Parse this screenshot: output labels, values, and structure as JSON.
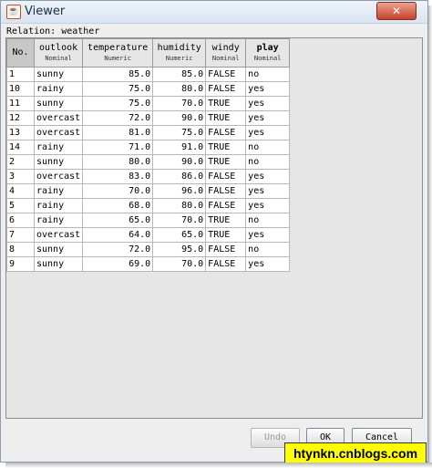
{
  "window": {
    "title": "Viewer",
    "icon": "java-coffee-icon",
    "close_glyph": "✕"
  },
  "relation_label": "Relation: weather",
  "table": {
    "index_header": "No.",
    "columns": [
      {
        "name": "outlook",
        "type": "Nominal"
      },
      {
        "name": "temperature",
        "type": "Numeric"
      },
      {
        "name": "humidity",
        "type": "Numeric"
      },
      {
        "name": "windy",
        "type": "Nominal"
      },
      {
        "name": "play",
        "type": "Nominal"
      }
    ],
    "rows": [
      [
        "1",
        "sunny",
        "85.0",
        "85.0",
        "FALSE",
        "no"
      ],
      [
        "10",
        "rainy",
        "75.0",
        "80.0",
        "FALSE",
        "yes"
      ],
      [
        "11",
        "sunny",
        "75.0",
        "70.0",
        "TRUE",
        "yes"
      ],
      [
        "12",
        "overcast",
        "72.0",
        "90.0",
        "TRUE",
        "yes"
      ],
      [
        "13",
        "overcast",
        "81.0",
        "75.0",
        "FALSE",
        "yes"
      ],
      [
        "14",
        "rainy",
        "71.0",
        "91.0",
        "TRUE",
        "no"
      ],
      [
        "2",
        "sunny",
        "80.0",
        "90.0",
        "TRUE",
        "no"
      ],
      [
        "3",
        "overcast",
        "83.0",
        "86.0",
        "FALSE",
        "yes"
      ],
      [
        "4",
        "rainy",
        "70.0",
        "96.0",
        "FALSE",
        "yes"
      ],
      [
        "5",
        "rainy",
        "68.0",
        "80.0",
        "FALSE",
        "yes"
      ],
      [
        "6",
        "rainy",
        "65.0",
        "70.0",
        "TRUE",
        "no"
      ],
      [
        "7",
        "overcast",
        "64.0",
        "65.0",
        "TRUE",
        "yes"
      ],
      [
        "8",
        "sunny",
        "72.0",
        "95.0",
        "FALSE",
        "no"
      ],
      [
        "9",
        "sunny",
        "69.0",
        "70.0",
        "FALSE",
        "yes"
      ]
    ]
  },
  "buttons": {
    "undo": "Undo",
    "ok": "OK",
    "cancel": "Cancel"
  },
  "watermark": "htynkn.cnblogs.com"
}
